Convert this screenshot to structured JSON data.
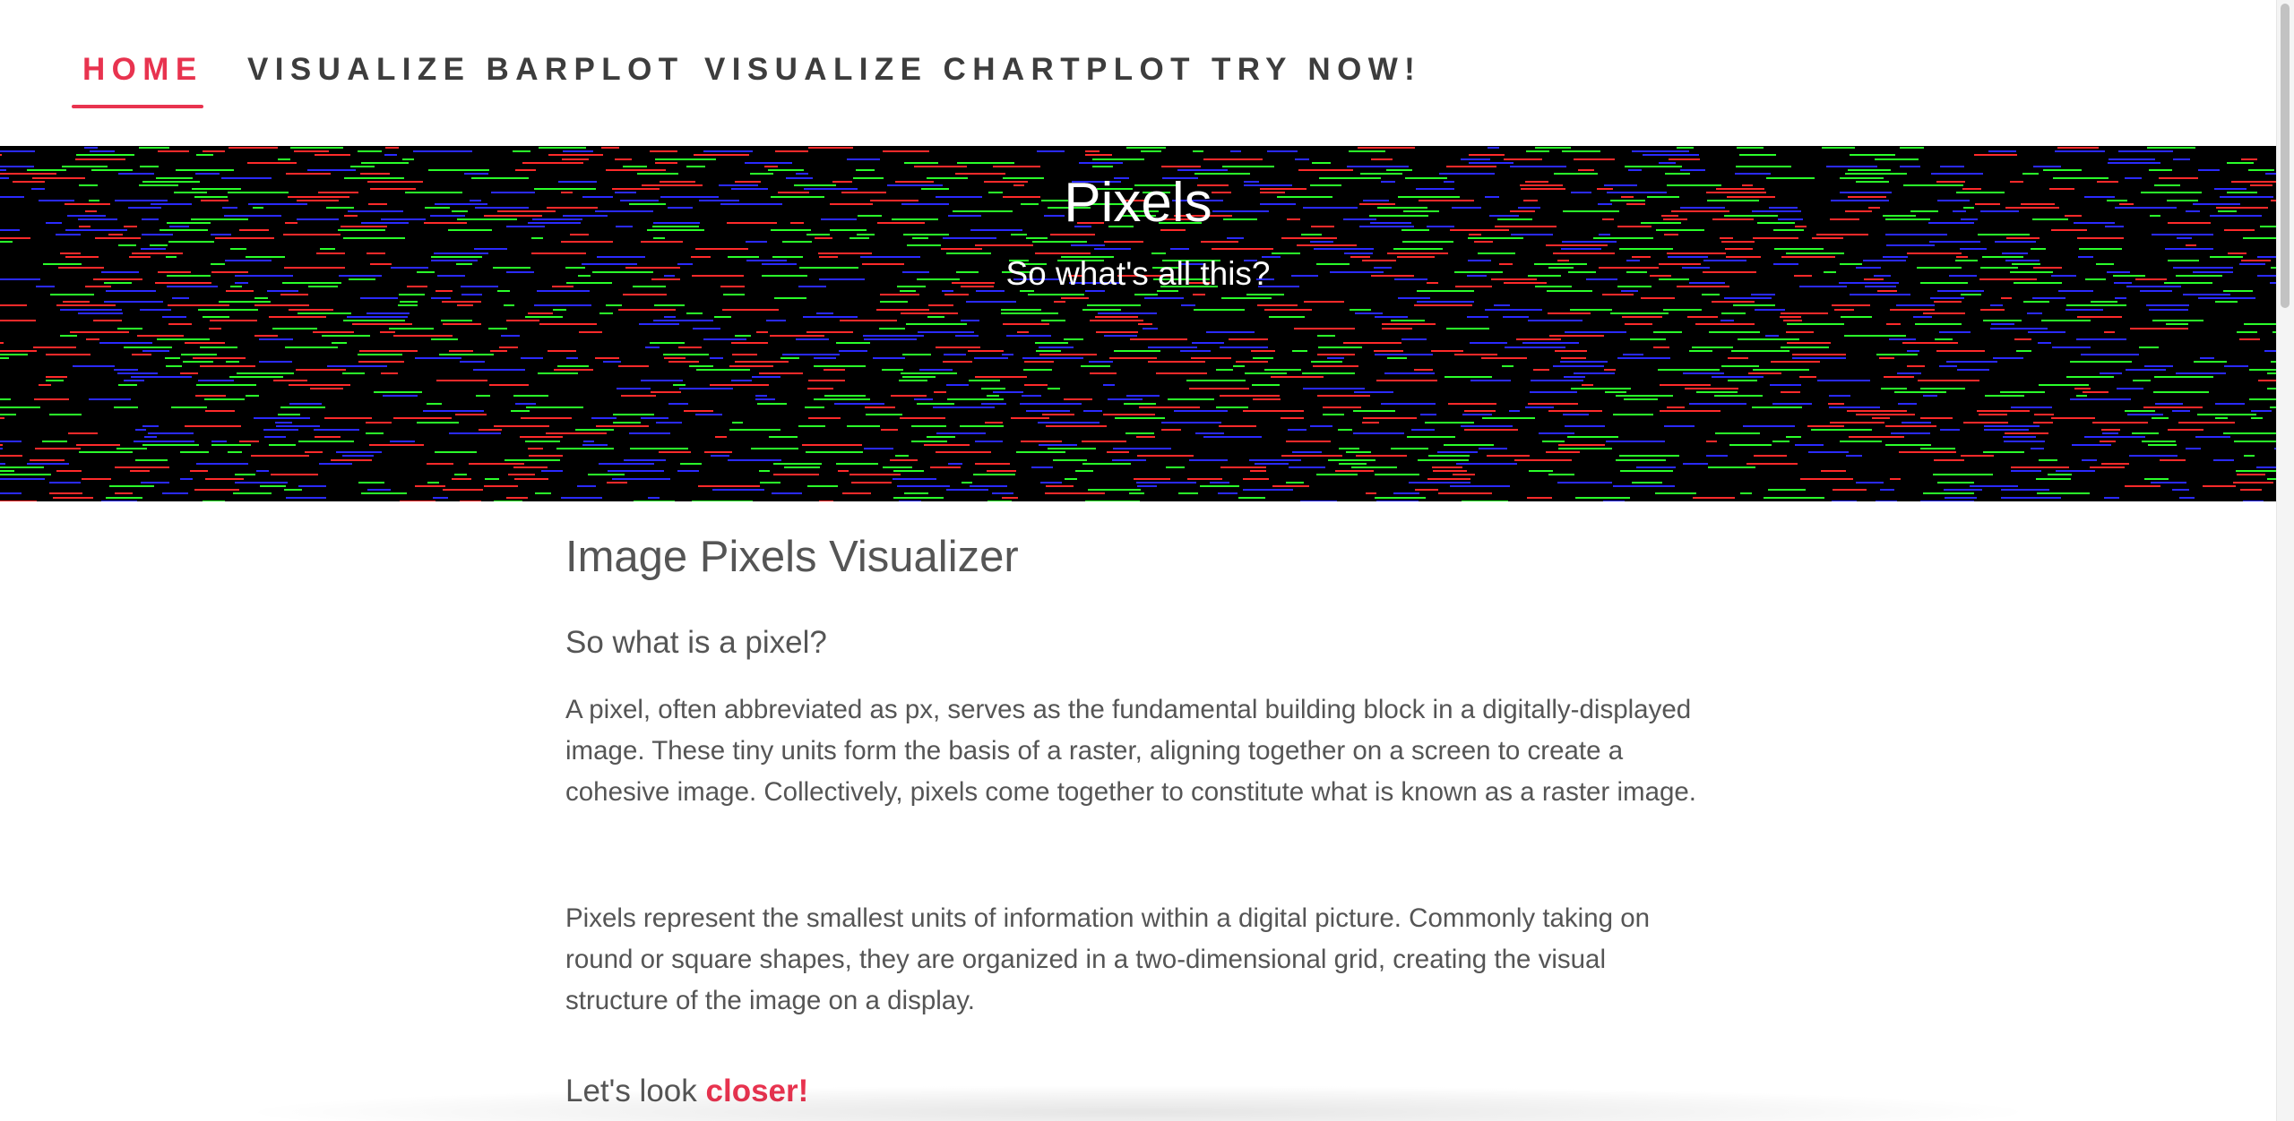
{
  "nav": {
    "items": [
      {
        "label": "HOME",
        "active": true
      },
      {
        "label": "VISUALIZE BARPLOT",
        "active": false
      },
      {
        "label": "VISUALIZE CHARTPLOT",
        "active": false
      },
      {
        "label": "TRY NOW!",
        "active": false
      }
    ]
  },
  "hero": {
    "title": "Pixels",
    "subtitle": "So what's all this?",
    "background_color": "#000000",
    "stripe_colors": [
      "#ff2a2a",
      "#2aff2a",
      "#2a2aff"
    ]
  },
  "main": {
    "title": "Image Pixels Visualizer",
    "section_heading": "So what is a pixel?",
    "paragraphs": [
      "A pixel, often abbreviated as px, serves as the fundamental building block in a digitally-displayed image. These tiny units form the basis of a raster, aligning together on a screen to create a cohesive image. Collectively, pixels come together to constitute what is known as a raster image.",
      "Pixels represent the smallest units of information within a digital picture. Commonly taking on round or square shapes, they are organized in a two-dimensional grid, creating the visual structure of the image on a display."
    ],
    "closer_heading": {
      "prefix": "Let's look ",
      "highlight": "closer!"
    }
  },
  "colors": {
    "accent": "#e8334f",
    "nav_text": "#3d3d3d",
    "body_text": "#555555"
  }
}
